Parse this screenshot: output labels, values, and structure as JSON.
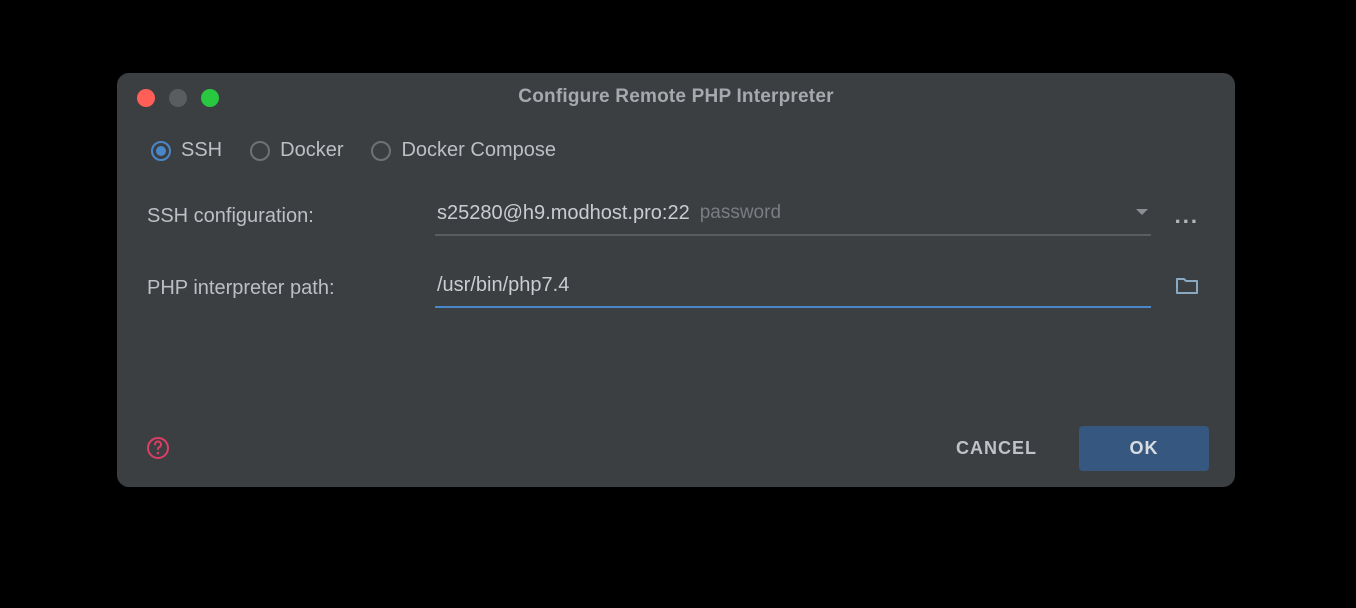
{
  "title": "Configure Remote PHP Interpreter",
  "radios": {
    "ssh": "SSH",
    "docker": "Docker",
    "docker_compose": "Docker Compose"
  },
  "fields": {
    "ssh_label": "SSH configuration:",
    "ssh_value": "s25280@h9.modhost.pro:22",
    "ssh_hint": "password",
    "path_label": "PHP interpreter path:",
    "path_value": "/usr/bin/php7.4"
  },
  "buttons": {
    "cancel": "CANCEL",
    "ok": "OK",
    "ellipsis": "..."
  }
}
